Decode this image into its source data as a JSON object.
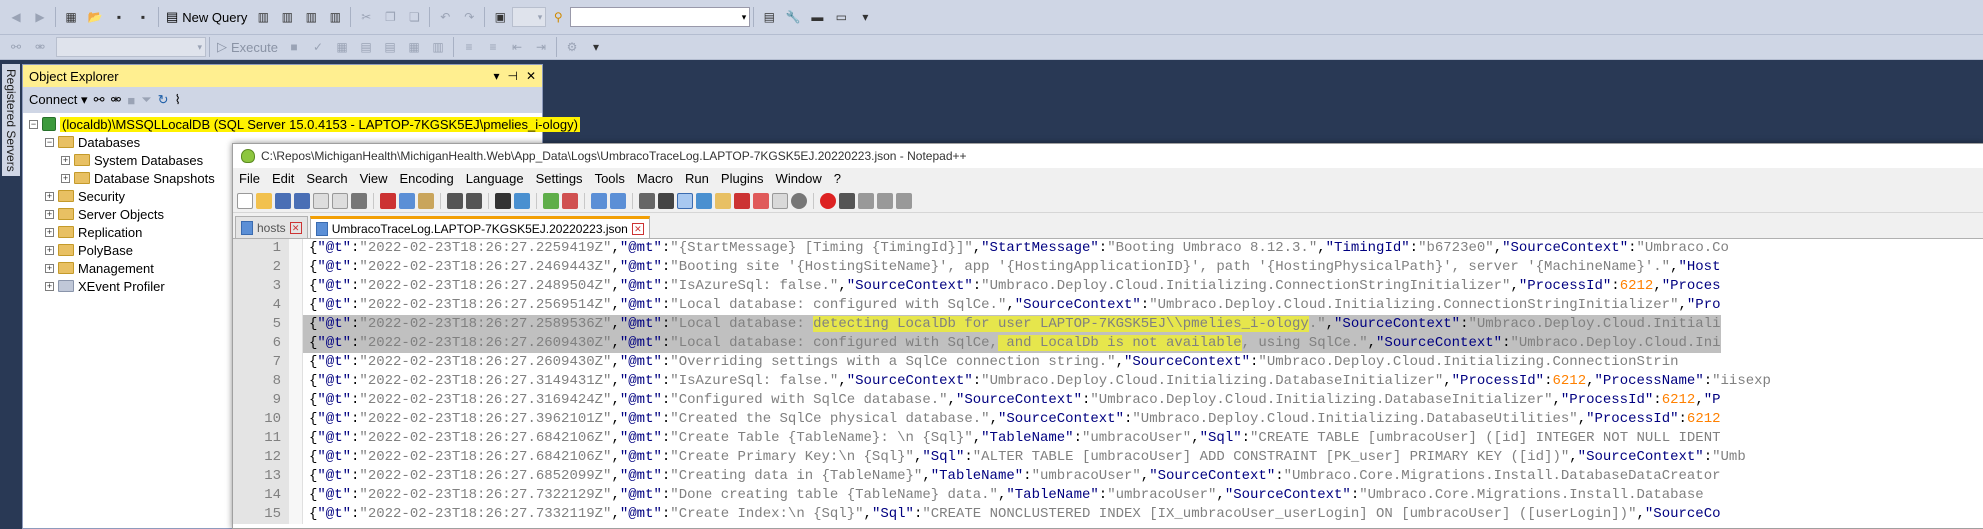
{
  "ssms": {
    "new_query_label": "New Query",
    "execute_label": "Execute",
    "registered_servers_label": "Registered Servers",
    "toolbar_icons": [
      "back-icon",
      "forward-icon",
      "new-project-icon",
      "open-file-icon",
      "save-icon",
      "save-all-icon",
      "new-query-icon",
      "mdx-icon",
      "dmx-icon",
      "xmla-icon",
      "dax-icon",
      "cut-icon",
      "copy-icon",
      "paste-icon",
      "undo-icon",
      "redo-icon",
      "activity-monitor-icon",
      "search-icon",
      "properties-icon",
      "toolbox-icon"
    ]
  },
  "object_explorer": {
    "title": "Object Explorer",
    "connect_label": "Connect",
    "server_node": "(localdb)\\MSSQLLocalDB (SQL Server 15.0.4153 - LAPTOP-7KGSK5EJ\\pmelies_i-ology)",
    "nodes": [
      {
        "label": "Databases",
        "level": 1,
        "expander": "-"
      },
      {
        "label": "System Databases",
        "level": 2,
        "expander": "+"
      },
      {
        "label": "Database Snapshots",
        "level": 2,
        "expander": "+"
      },
      {
        "label": "Security",
        "level": 1,
        "expander": "+"
      },
      {
        "label": "Server Objects",
        "level": 1,
        "expander": "+"
      },
      {
        "label": "Replication",
        "level": 1,
        "expander": "+"
      },
      {
        "label": "PolyBase",
        "level": 1,
        "expander": "+"
      },
      {
        "label": "Management",
        "level": 1,
        "expander": "+"
      },
      {
        "label": "XEvent Profiler",
        "level": 1,
        "expander": "+"
      }
    ]
  },
  "notepad": {
    "title": "C:\\Repos\\MichiganHealth\\MichiganHealth.Web\\App_Data\\Logs\\UmbracoTraceLog.LAPTOP-7KGSK5EJ.20220223.json - Notepad++",
    "menu": [
      "File",
      "Edit",
      "Search",
      "View",
      "Encoding",
      "Language",
      "Settings",
      "Tools",
      "Macro",
      "Run",
      "Plugins",
      "Window",
      "?"
    ],
    "tabs": [
      {
        "label": "hosts",
        "active": false
      },
      {
        "label": "UmbracoTraceLog.LAPTOP-7KGSK5EJ.20220223.json",
        "active": true
      }
    ],
    "lines": [
      {
        "num": "1",
        "sel": false,
        "segs": [
          [
            "p",
            "{"
          ],
          [
            "k",
            "\"@t\""
          ],
          [
            "p",
            ":"
          ],
          [
            "s",
            "\"2022-02-23T18:26:27.2259419Z\""
          ],
          [
            "p",
            ","
          ],
          [
            "k",
            "\"@mt\""
          ],
          [
            "p",
            ":"
          ],
          [
            "s",
            "\"{StartMessage} [Timing {TimingId}]\""
          ],
          [
            "p",
            ","
          ],
          [
            "k",
            "\"StartMessage\""
          ],
          [
            "p",
            ":"
          ],
          [
            "s",
            "\"Booting Umbraco 8.12.3.\""
          ],
          [
            "p",
            ","
          ],
          [
            "k",
            "\"TimingId\""
          ],
          [
            "p",
            ":"
          ],
          [
            "s",
            "\"b6723e0\""
          ],
          [
            "p",
            ","
          ],
          [
            "k",
            "\"SourceContext\""
          ],
          [
            "p",
            ":"
          ],
          [
            "s",
            "\"Umbraco.Co"
          ]
        ]
      },
      {
        "num": "2",
        "sel": false,
        "segs": [
          [
            "p",
            "{"
          ],
          [
            "k",
            "\"@t\""
          ],
          [
            "p",
            ":"
          ],
          [
            "s",
            "\"2022-02-23T18:26:27.2469443Z\""
          ],
          [
            "p",
            ","
          ],
          [
            "k",
            "\"@mt\""
          ],
          [
            "p",
            ":"
          ],
          [
            "s",
            "\"Booting site '{HostingSiteName}', app '{HostingApplicationID}', path '{HostingPhysicalPath}', server '{MachineName}'.\""
          ],
          [
            "p",
            ","
          ],
          [
            "k",
            "\"Host"
          ]
        ]
      },
      {
        "num": "3",
        "sel": false,
        "segs": [
          [
            "p",
            "{"
          ],
          [
            "k",
            "\"@t\""
          ],
          [
            "p",
            ":"
          ],
          [
            "s",
            "\"2022-02-23T18:26:27.2489504Z\""
          ],
          [
            "p",
            ","
          ],
          [
            "k",
            "\"@mt\""
          ],
          [
            "p",
            ":"
          ],
          [
            "s",
            "\"IsAzureSql: false.\""
          ],
          [
            "p",
            ","
          ],
          [
            "k",
            "\"SourceContext\""
          ],
          [
            "p",
            ":"
          ],
          [
            "s",
            "\"Umbraco.Deploy.Cloud.Initializing.ConnectionStringInitializer\""
          ],
          [
            "p",
            ","
          ],
          [
            "k",
            "\"ProcessId\""
          ],
          [
            "p",
            ":"
          ],
          [
            "n",
            "6212"
          ],
          [
            "p",
            ","
          ],
          [
            "k",
            "\"Proces"
          ]
        ]
      },
      {
        "num": "4",
        "sel": false,
        "segs": [
          [
            "p",
            "{"
          ],
          [
            "k",
            "\"@t\""
          ],
          [
            "p",
            ":"
          ],
          [
            "s",
            "\"2022-02-23T18:26:27.2569514Z\""
          ],
          [
            "p",
            ","
          ],
          [
            "k",
            "\"@mt\""
          ],
          [
            "p",
            ":"
          ],
          [
            "s",
            "\"Local database: configured with SqlCe.\""
          ],
          [
            "p",
            ","
          ],
          [
            "k",
            "\"SourceContext\""
          ],
          [
            "p",
            ":"
          ],
          [
            "s",
            "\"Umbraco.Deploy.Cloud.Initializing.ConnectionStringInitializer\""
          ],
          [
            "p",
            ","
          ],
          [
            "k",
            "\"Pro"
          ]
        ]
      },
      {
        "num": "5",
        "sel": true,
        "segs": [
          [
            "p",
            "{"
          ],
          [
            "k",
            "\"@t\""
          ],
          [
            "p",
            ":"
          ],
          [
            "s",
            "\"2022-02-23T18:26:27.2589536Z\""
          ],
          [
            "p",
            ","
          ],
          [
            "k",
            "\"@mt\""
          ],
          [
            "p",
            ":"
          ],
          [
            "s",
            "\"Local database: "
          ],
          [
            "m",
            "detecting LocalDb for user LAPTOP-7KGSK5EJ\\\\pmelies_i-ology"
          ],
          [
            "s",
            ".\""
          ],
          [
            "p",
            ","
          ],
          [
            "k",
            "\"SourceContext\""
          ],
          [
            "p",
            ":"
          ],
          [
            "s",
            "\"Umbraco.Deploy.Cloud.Initiali"
          ]
        ]
      },
      {
        "num": "6",
        "sel": true,
        "segs": [
          [
            "p",
            "{"
          ],
          [
            "k",
            "\"@t\""
          ],
          [
            "p",
            ":"
          ],
          [
            "s",
            "\"2022-02-23T18:26:27.2609430Z\""
          ],
          [
            "p",
            ","
          ],
          [
            "k",
            "\"@mt\""
          ],
          [
            "p",
            ":"
          ],
          [
            "s",
            "\"Local database: configured with SqlCe,"
          ],
          [
            "m",
            " and LocalDb is not available"
          ],
          [
            "s",
            ", using SqlCe.\""
          ],
          [
            "p",
            ","
          ],
          [
            "k",
            "\"SourceContext\""
          ],
          [
            "p",
            ":"
          ],
          [
            "s",
            "\"Umbraco.Deploy.Cloud.Ini"
          ]
        ]
      },
      {
        "num": "7",
        "sel": false,
        "segs": [
          [
            "p",
            "{"
          ],
          [
            "k",
            "\"@t\""
          ],
          [
            "p",
            ":"
          ],
          [
            "s",
            "\"2022-02-23T18:26:27.2609430Z\""
          ],
          [
            "p",
            ","
          ],
          [
            "k",
            "\"@mt\""
          ],
          [
            "p",
            ":"
          ],
          [
            "s",
            "\"Overriding settings with a SqlCe connection string.\""
          ],
          [
            "p",
            ","
          ],
          [
            "k",
            "\"SourceContext\""
          ],
          [
            "p",
            ":"
          ],
          [
            "s",
            "\"Umbraco.Deploy.Cloud.Initializing.ConnectionStrin"
          ]
        ]
      },
      {
        "num": "8",
        "sel": false,
        "segs": [
          [
            "p",
            "{"
          ],
          [
            "k",
            "\"@t\""
          ],
          [
            "p",
            ":"
          ],
          [
            "s",
            "\"2022-02-23T18:26:27.3149431Z\""
          ],
          [
            "p",
            ","
          ],
          [
            "k",
            "\"@mt\""
          ],
          [
            "p",
            ":"
          ],
          [
            "s",
            "\"IsAzureSql: false.\""
          ],
          [
            "p",
            ","
          ],
          [
            "k",
            "\"SourceContext\""
          ],
          [
            "p",
            ":"
          ],
          [
            "s",
            "\"Umbraco.Deploy.Cloud.Initializing.DatabaseInitializer\""
          ],
          [
            "p",
            ","
          ],
          [
            "k",
            "\"ProcessId\""
          ],
          [
            "p",
            ":"
          ],
          [
            "n",
            "6212"
          ],
          [
            "p",
            ","
          ],
          [
            "k",
            "\"ProcessName\""
          ],
          [
            "p",
            ":"
          ],
          [
            "s",
            "\"iisexp"
          ]
        ]
      },
      {
        "num": "9",
        "sel": false,
        "segs": [
          [
            "p",
            "{"
          ],
          [
            "k",
            "\"@t\""
          ],
          [
            "p",
            ":"
          ],
          [
            "s",
            "\"2022-02-23T18:26:27.3169424Z\""
          ],
          [
            "p",
            ","
          ],
          [
            "k",
            "\"@mt\""
          ],
          [
            "p",
            ":"
          ],
          [
            "s",
            "\"Configured with SqlCe database.\""
          ],
          [
            "p",
            ","
          ],
          [
            "k",
            "\"SourceContext\""
          ],
          [
            "p",
            ":"
          ],
          [
            "s",
            "\"Umbraco.Deploy.Cloud.Initializing.DatabaseInitializer\""
          ],
          [
            "p",
            ","
          ],
          [
            "k",
            "\"ProcessId\""
          ],
          [
            "p",
            ":"
          ],
          [
            "n",
            "6212"
          ],
          [
            "p",
            ","
          ],
          [
            "k",
            "\"P"
          ]
        ]
      },
      {
        "num": "10",
        "sel": false,
        "segs": [
          [
            "p",
            "{"
          ],
          [
            "k",
            "\"@t\""
          ],
          [
            "p",
            ":"
          ],
          [
            "s",
            "\"2022-02-23T18:26:27.3962101Z\""
          ],
          [
            "p",
            ","
          ],
          [
            "k",
            "\"@mt\""
          ],
          [
            "p",
            ":"
          ],
          [
            "s",
            "\"Created the SqlCe physical database.\""
          ],
          [
            "p",
            ","
          ],
          [
            "k",
            "\"SourceContext\""
          ],
          [
            "p",
            ":"
          ],
          [
            "s",
            "\"Umbraco.Deploy.Cloud.Initializing.DatabaseUtilities\""
          ],
          [
            "p",
            ","
          ],
          [
            "k",
            "\"ProcessId\""
          ],
          [
            "p",
            ":"
          ],
          [
            "n",
            "6212"
          ]
        ]
      },
      {
        "num": "11",
        "sel": false,
        "segs": [
          [
            "p",
            "{"
          ],
          [
            "k",
            "\"@t\""
          ],
          [
            "p",
            ":"
          ],
          [
            "s",
            "\"2022-02-23T18:26:27.6842106Z\""
          ],
          [
            "p",
            ","
          ],
          [
            "k",
            "\"@mt\""
          ],
          [
            "p",
            ":"
          ],
          [
            "s",
            "\"Create Table {TableName}: \\n {Sql}\""
          ],
          [
            "p",
            ","
          ],
          [
            "k",
            "\"TableName\""
          ],
          [
            "p",
            ":"
          ],
          [
            "s",
            "\"umbracoUser\""
          ],
          [
            "p",
            ","
          ],
          [
            "k",
            "\"Sql\""
          ],
          [
            "p",
            ":"
          ],
          [
            "s",
            "\"CREATE TABLE [umbracoUser] ([id] INTEGER NOT NULL IDENT"
          ]
        ]
      },
      {
        "num": "12",
        "sel": false,
        "segs": [
          [
            "p",
            "{"
          ],
          [
            "k",
            "\"@t\""
          ],
          [
            "p",
            ":"
          ],
          [
            "s",
            "\"2022-02-23T18:26:27.6842106Z\""
          ],
          [
            "p",
            ","
          ],
          [
            "k",
            "\"@mt\""
          ],
          [
            "p",
            ":"
          ],
          [
            "s",
            "\"Create Primary Key:\\n {Sql}\""
          ],
          [
            "p",
            ","
          ],
          [
            "k",
            "\"Sql\""
          ],
          [
            "p",
            ":"
          ],
          [
            "s",
            "\"ALTER TABLE [umbracoUser] ADD CONSTRAINT [PK_user] PRIMARY KEY ([id])\""
          ],
          [
            "p",
            ","
          ],
          [
            "k",
            "\"SourceContext\""
          ],
          [
            "p",
            ":"
          ],
          [
            "s",
            "\"Umb"
          ]
        ]
      },
      {
        "num": "13",
        "sel": false,
        "segs": [
          [
            "p",
            "{"
          ],
          [
            "k",
            "\"@t\""
          ],
          [
            "p",
            ":"
          ],
          [
            "s",
            "\"2022-02-23T18:26:27.6852099Z\""
          ],
          [
            "p",
            ","
          ],
          [
            "k",
            "\"@mt\""
          ],
          [
            "p",
            ":"
          ],
          [
            "s",
            "\"Creating data in {TableName}\""
          ],
          [
            "p",
            ","
          ],
          [
            "k",
            "\"TableName\""
          ],
          [
            "p",
            ":"
          ],
          [
            "s",
            "\"umbracoUser\""
          ],
          [
            "p",
            ","
          ],
          [
            "k",
            "\"SourceContext\""
          ],
          [
            "p",
            ":"
          ],
          [
            "s",
            "\"Umbraco.Core.Migrations.Install.DatabaseDataCreator"
          ]
        ]
      },
      {
        "num": "14",
        "sel": false,
        "segs": [
          [
            "p",
            "{"
          ],
          [
            "k",
            "\"@t\""
          ],
          [
            "p",
            ":"
          ],
          [
            "s",
            "\"2022-02-23T18:26:27.7322129Z\""
          ],
          [
            "p",
            ","
          ],
          [
            "k",
            "\"@mt\""
          ],
          [
            "p",
            ":"
          ],
          [
            "s",
            "\"Done creating table {TableName} data.\""
          ],
          [
            "p",
            ","
          ],
          [
            "k",
            "\"TableName\""
          ],
          [
            "p",
            ":"
          ],
          [
            "s",
            "\"umbracoUser\""
          ],
          [
            "p",
            ","
          ],
          [
            "k",
            "\"SourceContext\""
          ],
          [
            "p",
            ":"
          ],
          [
            "s",
            "\"Umbraco.Core.Migrations.Install.Database"
          ]
        ]
      },
      {
        "num": "15",
        "sel": false,
        "segs": [
          [
            "p",
            "{"
          ],
          [
            "k",
            "\"@t\""
          ],
          [
            "p",
            ":"
          ],
          [
            "s",
            "\"2022-02-23T18:26:27.7332119Z\""
          ],
          [
            "p",
            ","
          ],
          [
            "k",
            "\"@mt\""
          ],
          [
            "p",
            ":"
          ],
          [
            "s",
            "\"Create Index:\\n {Sql}\""
          ],
          [
            "p",
            ","
          ],
          [
            "k",
            "\"Sql\""
          ],
          [
            "p",
            ":"
          ],
          [
            "s",
            "\"CREATE NONCLUSTERED INDEX [IX_umbracoUser_userLogin] ON [umbracoUser] ([userLogin])\""
          ],
          [
            "p",
            ","
          ],
          [
            "k",
            "\"SourceCo"
          ]
        ]
      }
    ]
  }
}
